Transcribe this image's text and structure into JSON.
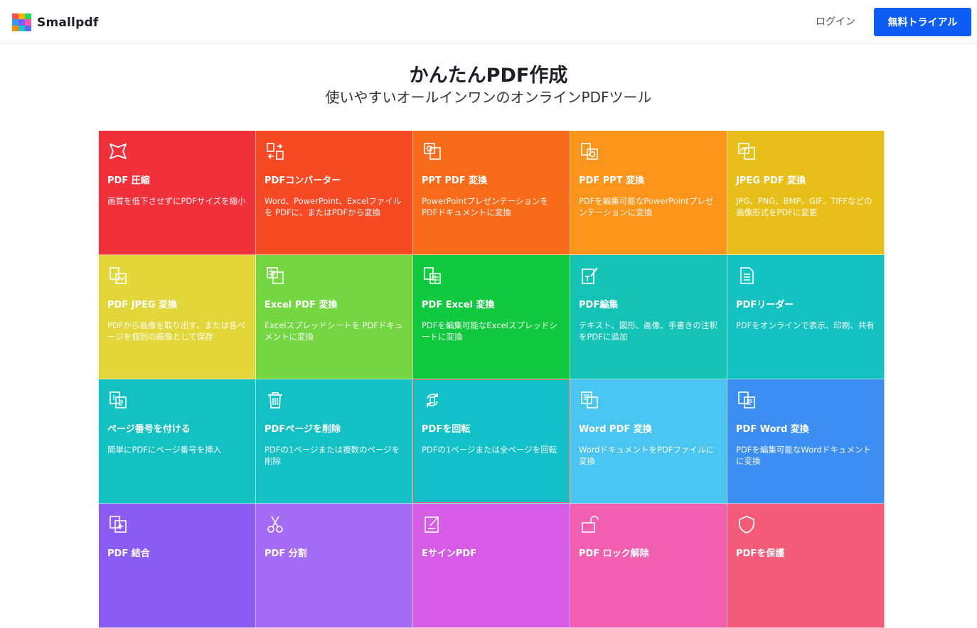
{
  "header": {
    "brand": "Smallpdf",
    "login_label": "ログイン",
    "trial_label": "無料トライアル",
    "logo_colors": [
      "#ff4f4f",
      "#ffb400",
      "#2bd45c",
      "#2d9bff",
      "#7a5cff",
      "#ff5aa5",
      "#ff8a00",
      "#18c7c7",
      "#5c6cff"
    ]
  },
  "hero": {
    "title": "かんたんPDF作成",
    "subtitle": "使いやすいオールインワンのオンラインPDFツール"
  },
  "tools": [
    {
      "title": "PDF 圧縮",
      "desc": "画質を低下させずにPDFサイズを縮小",
      "color": "#f0313b",
      "icon": "compress-icon"
    },
    {
      "title": "PDFコンバーター",
      "desc": "Word、PowerPoint、Excelファイルを PDFに、またはPDFから変換",
      "color": "#f64a25",
      "icon": "convert-icon"
    },
    {
      "title": "PPT PDF 変換",
      "desc": "PowerPointプレゼンテーションをPDFドキュメントに変換",
      "color": "#f86b1b",
      "icon": "ppt-to-pdf-icon"
    },
    {
      "title": "PDF PPT 変換",
      "desc": "PDFを編集可能なPowerPointプレゼンテーションに変換",
      "color": "#fb941a",
      "icon": "pdf-to-ppt-icon"
    },
    {
      "title": "JPEG PDF 変換",
      "desc": "JPG、PNG、BMP、GIF、TIFFなどの画像形式をPDFに変更",
      "color": "#e8be19",
      "icon": "jpg-to-pdf-icon"
    },
    {
      "title": "PDF JPEG 変換",
      "desc": "PDFから画像を取り出す、または各ページを個別の画像として保存",
      "color": "#e3d63a",
      "icon": "pdf-to-jpg-icon"
    },
    {
      "title": "Excel PDF 変換",
      "desc": "Excelスプレッドシートを PDFドキュメントに変換",
      "color": "#74d640",
      "icon": "excel-to-pdf-icon"
    },
    {
      "title": "PDF Excel 変換",
      "desc": "PDFを編集可能なExcelスプレッドシートに変換",
      "color": "#11c93f",
      "icon": "pdf-to-excel-icon"
    },
    {
      "title": "PDF編集",
      "desc": "テキスト、図形、画像、手書きの注釈をPDFに追加",
      "color": "#15c3b6",
      "icon": "edit-pdf-icon"
    },
    {
      "title": "PDFリーダー",
      "desc": "PDFをオンラインで表示、印刷、共有",
      "color": "#14c2c1",
      "icon": "pdf-reader-icon"
    },
    {
      "title": "ページ番号を付ける",
      "desc": "簡単にPDFにページ番号を挿入",
      "color": "#13c1c2",
      "icon": "page-numbers-icon"
    },
    {
      "title": "PDFページを削除",
      "desc": "PDFの1ページまたは複数のページを削除",
      "color": "#13c1c5",
      "icon": "delete-pages-icon"
    },
    {
      "title": "PDFを回転",
      "desc": "PDFの1ページまたは全ページを回転",
      "color": "#12c0c7",
      "icon": "rotate-icon"
    },
    {
      "title": "Word PDF 変換",
      "desc": "WordドキュメントをPDFファイルに変換",
      "color": "#4ac5ef",
      "icon": "word-to-pdf-icon"
    },
    {
      "title": "PDF Word 変換",
      "desc": "PDFを編集可能なWordドキュメントに変換",
      "color": "#3c8ff0",
      "icon": "pdf-to-word-icon"
    },
    {
      "title": "PDF 結合",
      "desc": "",
      "color": "#8b5cf2",
      "icon": "merge-icon"
    },
    {
      "title": "PDF 分割",
      "desc": "",
      "color": "#a66bf5",
      "icon": "split-icon"
    },
    {
      "title": "EサインPDF",
      "desc": "",
      "color": "#d65ce6",
      "icon": "esign-icon"
    },
    {
      "title": "PDF ロック解除",
      "desc": "",
      "color": "#f35fb0",
      "icon": "unlock-icon"
    },
    {
      "title": "PDFを保護",
      "desc": "",
      "color": "#f55a78",
      "icon": "protect-icon"
    }
  ]
}
